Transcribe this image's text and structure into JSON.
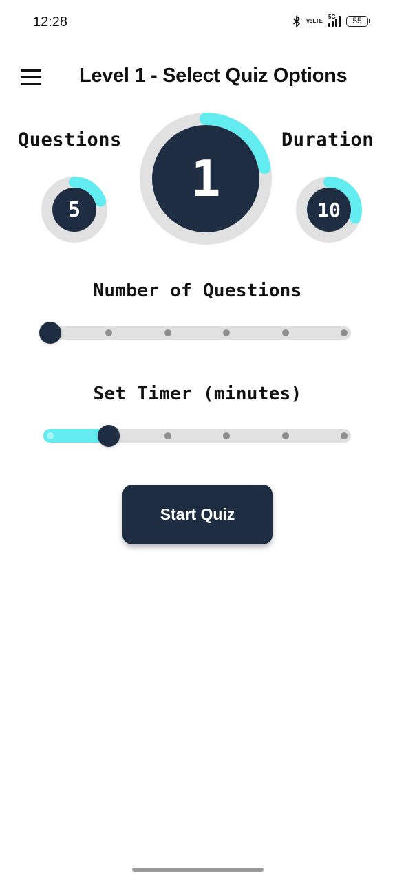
{
  "status_bar": {
    "time": "12:28",
    "network": "5G",
    "volte": [
      "Vo",
      "LTE"
    ],
    "battery": "55",
    "icons": [
      "bluetooth-icon",
      "volte-icon",
      "signal-icon",
      "battery-icon"
    ]
  },
  "header": {
    "title": "Level 1 - Select Quiz Options",
    "menu_icon": "hamburger-menu-icon"
  },
  "dials": {
    "level": {
      "value": "1",
      "progress": 0.22
    },
    "questions": {
      "label": "Questions",
      "value": "5",
      "progress": 0.2
    },
    "duration": {
      "label": "Duration",
      "value": "10",
      "progress": 0.3
    }
  },
  "questions_slider": {
    "heading": "Number of Questions",
    "steps": 6,
    "selected_index": 0
  },
  "timer_slider": {
    "heading": "Set Timer (minutes)",
    "steps": 6,
    "selected_index": 1
  },
  "start_button": {
    "label": "Start Quiz"
  },
  "colors": {
    "primary": "#1e2d42",
    "accent": "#62ecef",
    "track": "#e1e1e1",
    "tick": "#8f8f8f"
  }
}
